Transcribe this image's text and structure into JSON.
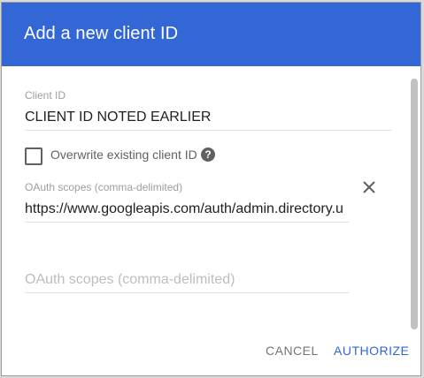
{
  "dialog": {
    "title": "Add a new client ID"
  },
  "client_id": {
    "label": "Client ID",
    "value": "CLIENT ID NOTED EARLIER"
  },
  "overwrite": {
    "label": "Overwrite existing client ID",
    "checked": false,
    "help_icon": "help-icon"
  },
  "scopes": {
    "label": "OAuth scopes (comma-delimited)",
    "value": "https://www.googleapis.com/auth/admin.directory.u",
    "new_placeholder": "OAuth scopes (comma-delimited)",
    "remove_icon": "close-icon"
  },
  "actions": {
    "cancel": "CANCEL",
    "authorize": "AUTHORIZE"
  },
  "colors": {
    "header": "#3367d6",
    "accent": "#3367d6"
  }
}
